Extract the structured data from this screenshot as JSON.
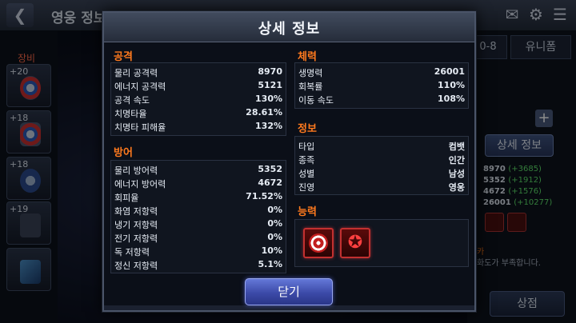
{
  "screen": {
    "title": "영웅 정보",
    "equip_label": "장비",
    "equip_slots": [
      "+20",
      "+18",
      "+18",
      "+19",
      ""
    ],
    "tab_partial": "0-8",
    "tab_uniform": "유니폼",
    "detail_button": "상세 정보",
    "stats_partial": [
      {
        "base": "8970",
        "bonus": "(+3685)"
      },
      {
        "base": "5352",
        "bonus": "(+1912)"
      },
      {
        "base": "4672",
        "bonus": "(+1576)"
      },
      {
        "base": "26001",
        "bonus": "(+10277)"
      }
    ],
    "warn_partial": "화도가 부족합니다.",
    "warn_partial_top": "카",
    "shop_button": "상점"
  },
  "modal": {
    "title": "상세 정보",
    "attack": {
      "title": "공격",
      "rows": [
        {
          "label": "물리 공격력",
          "value": "8970"
        },
        {
          "label": "에너지 공격력",
          "value": "5121"
        },
        {
          "label": "공격 속도",
          "value": "130%"
        },
        {
          "label": "치명타율",
          "value": "28.61%"
        },
        {
          "label": "치명타 피해율",
          "value": "132%"
        }
      ]
    },
    "defense": {
      "title": "방어",
      "rows": [
        {
          "label": "물리 방어력",
          "value": "5352"
        },
        {
          "label": "에너지 방어력",
          "value": "4672"
        },
        {
          "label": "회피율",
          "value": "71.52%"
        },
        {
          "label": "화염 저항력",
          "value": "0%"
        },
        {
          "label": "냉기 저항력",
          "value": "0%"
        },
        {
          "label": "전기 저항력",
          "value": "0%"
        },
        {
          "label": "독 저항력",
          "value": "10%"
        },
        {
          "label": "정신 저항력",
          "value": "5.1%"
        }
      ]
    },
    "health": {
      "title": "체력",
      "rows": [
        {
          "label": "생명력",
          "value": "26001"
        },
        {
          "label": "회복률",
          "value": "110%"
        },
        {
          "label": "이동 속도",
          "value": "108%"
        }
      ]
    },
    "info": {
      "title": "정보",
      "rows": [
        {
          "label": "타입",
          "value": "컴뱃"
        },
        {
          "label": "종족",
          "value": "인간"
        },
        {
          "label": "성별",
          "value": "남성"
        },
        {
          "label": "진영",
          "value": "영웅"
        }
      ]
    },
    "abilities": {
      "title": "능력",
      "icons": [
        "shield-icon",
        "medal-icon"
      ]
    },
    "close_button": "닫기"
  }
}
